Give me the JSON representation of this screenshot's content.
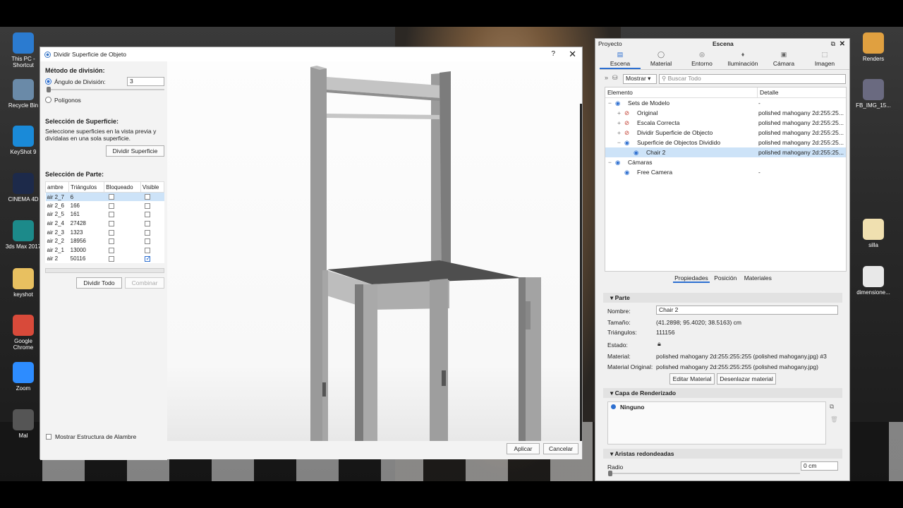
{
  "desktop": {
    "icons_left": [
      {
        "label": "This PC - Shortcut",
        "icon": "computer-icon",
        "color": "#2b7bd0"
      },
      {
        "label": "Recycle Bin",
        "icon": "recycle-bin-icon",
        "color": "#6a8aa8"
      },
      {
        "label": "KeyShot 9",
        "icon": "keyshot-icon",
        "color": "#1a8ad8"
      },
      {
        "label": "CINEMA 4D",
        "icon": "cinema4d-icon",
        "color": "#1d2a4a"
      },
      {
        "label": "3ds Max 2017",
        "icon": "3dsmax-icon",
        "color": "#1c8a8a"
      },
      {
        "label": "keyshot",
        "icon": "file-icon",
        "color": "#e8c060"
      },
      {
        "label": "Google Chrome",
        "icon": "chrome-icon",
        "color": "#d84a3a"
      },
      {
        "label": "Zoom",
        "icon": "zoom-icon",
        "color": "#2d8cff"
      },
      {
        "label": "Mal",
        "icon": "model-file-icon",
        "color": "#555"
      }
    ],
    "icons_right": [
      {
        "label": "Renders",
        "icon": "folder-icon",
        "color": "#e0a040"
      },
      {
        "label": "FB_IMG_15...",
        "icon": "image-icon",
        "color": "#6a6a80"
      },
      {
        "label": "silla",
        "icon": "image-icon",
        "color": "#f0e0b0"
      },
      {
        "label": "dimensione...",
        "icon": "image-icon",
        "color": "#e8e8e8"
      }
    ]
  },
  "dialog": {
    "title": "Dividir Superficie de Objeto",
    "help": "?",
    "close": "✕",
    "division_method_heading": "Método de división:",
    "angle_label": "Ángulo de División:",
    "angle_value": "3",
    "polygons_label": "Polígonos",
    "surface_heading": "Selección de Superficie:",
    "surface_desc": "Seleccione superficies en la vista previa y divídalas en una sola superficie.",
    "split_surface_button": "Dividir Superficie",
    "part_heading": "Selección de Parte:",
    "columns": [
      "ambre",
      "Triángulos",
      "Bloqueado",
      "Visible"
    ],
    "rows": [
      {
        "name": "air 2_7",
        "tri": "6",
        "locked": false,
        "visible": false,
        "selected": true
      },
      {
        "name": "air 2_6",
        "tri": "166",
        "locked": false,
        "visible": false
      },
      {
        "name": "air 2_5",
        "tri": "161",
        "locked": false,
        "visible": false
      },
      {
        "name": "air 2_4",
        "tri": "27428",
        "locked": false,
        "visible": false
      },
      {
        "name": "air 2_3",
        "tri": "1323",
        "locked": false,
        "visible": false
      },
      {
        "name": "air 2_2",
        "tri": "18956",
        "locked": false,
        "visible": false
      },
      {
        "name": "air 2_1",
        "tri": "13000",
        "locked": false,
        "visible": false
      },
      {
        "name": "air 2",
        "tri": "50116",
        "locked": false,
        "visible": true
      }
    ],
    "split_all_button": "Dividir Todo",
    "combine_button": "Combinar",
    "wireframe_label": "Mostrar Estructura de Alambre",
    "apply_button": "Aplicar",
    "cancel_button": "Cancelar"
  },
  "panel": {
    "project_label": "Proyecto",
    "title": "Escena",
    "tabs": [
      {
        "label": "Escena",
        "icon": "scene-icon",
        "glyph": "▤"
      },
      {
        "label": "Material",
        "icon": "material-icon",
        "glyph": "◯"
      },
      {
        "label": "Entorno",
        "icon": "environment-icon",
        "glyph": "◎"
      },
      {
        "label": "Iluminación",
        "icon": "light-icon",
        "glyph": "♦"
      },
      {
        "label": "Cámara",
        "icon": "camera-icon",
        "glyph": "▣"
      },
      {
        "label": "Imagen",
        "icon": "image-icon",
        "glyph": "⬚"
      }
    ],
    "show_label": "Mostrar",
    "search_placeholder": "Buscar Todo",
    "col_element": "Elemento",
    "col_detail": "Detalle",
    "tree": [
      {
        "label": "Sets de Modelo",
        "detail": "-",
        "indent": 0,
        "expander": "−"
      },
      {
        "label": "Original",
        "detail": "polished mahogany 2d:255:25...",
        "indent": 1,
        "expander": "+",
        "hidden": true
      },
      {
        "label": "Escala Correcta",
        "detail": "polished mahogany 2d:255:25...",
        "indent": 1,
        "expander": "+",
        "hidden": true
      },
      {
        "label": "Dividir Superficie de Objecto",
        "detail": "polished mahogany 2d:255:25...",
        "indent": 1,
        "expander": "+",
        "hidden": true
      },
      {
        "label": "Superficie de Objectos Dividido",
        "detail": "polished mahogany 2d:255:25...",
        "indent": 1,
        "expander": "−"
      },
      {
        "label": "Chair 2",
        "detail": "polished mahogany 2d:255:25...",
        "indent": 2,
        "expander": "",
        "selected": true
      },
      {
        "label": "Cámaras",
        "detail": "",
        "indent": 0,
        "expander": "−"
      },
      {
        "label": "Free Camera",
        "detail": "-",
        "indent": 1,
        "expander": ""
      }
    ],
    "subtabs": [
      "Propiedades",
      "Posición",
      "Materiales"
    ],
    "part_section": "Parte",
    "name_label": "Nombre:",
    "name_value": "Chair 2",
    "size_label": "Tamaño:",
    "size_value": "(41.2898; 95.4020; 38.5163) cm",
    "tri_label": "Triángulos:",
    "tri_value": "111156",
    "state_label": "Estado:",
    "material_label": "Material:",
    "material_value": "polished mahogany 2d:255:255:255 (polished mahogany.jpg) #3",
    "orig_material_label": "Material Original:",
    "orig_material_value": "polished mahogany 2d:255:255:255 (polished mahogany.jpg)",
    "edit_material_button": "Editar Material",
    "unlink_material_button": "Desenlazar material",
    "render_layer_section": "Capa de Renderizado",
    "render_layer_item": "Ninguno",
    "rounded_edges_section": "Aristas redondeadas",
    "radius_label": "Radio",
    "radius_value": "0 cm"
  }
}
